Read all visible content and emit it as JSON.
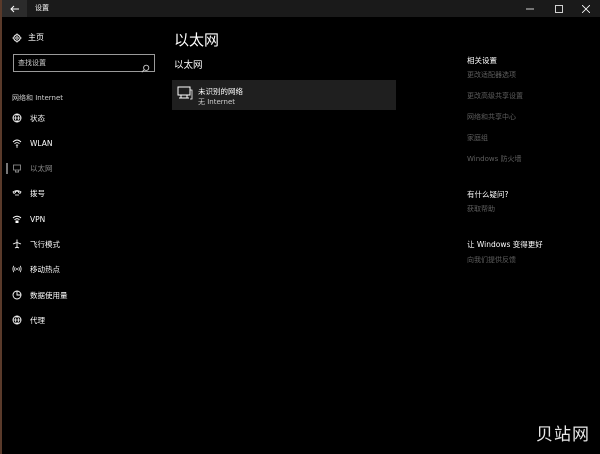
{
  "window": {
    "title": "设置"
  },
  "nav": {
    "home_label": "主页",
    "search_placeholder": "查找设置",
    "section_label": "网络和 Internet",
    "items": [
      {
        "label": "状态",
        "icon": "status-globe-icon"
      },
      {
        "label": "WLAN",
        "icon": "wifi-icon"
      },
      {
        "label": "以太网",
        "icon": "ethernet-icon",
        "selected": true
      },
      {
        "label": "拨号",
        "icon": "dialup-icon"
      },
      {
        "label": "VPN",
        "icon": "vpn-icon"
      },
      {
        "label": "飞行模式",
        "icon": "airplane-icon"
      },
      {
        "label": "移动热点",
        "icon": "hotspot-icon"
      },
      {
        "label": "数据使用量",
        "icon": "data-usage-icon"
      },
      {
        "label": "代理",
        "icon": "proxy-globe-icon"
      }
    ]
  },
  "main": {
    "title": "以太网",
    "section": "以太网",
    "network": {
      "name": "未识别的网络",
      "status": "无 Internet"
    }
  },
  "right": {
    "related_header": "相关设置",
    "related_links": [
      "更改适配器选项",
      "更改高级共享设置",
      "网络和共享中心",
      "家庭组",
      "Windows 防火墙"
    ],
    "help_header": "有什么疑问?",
    "help_link": "获取帮助",
    "feedback_header": "让 Windows 变得更好",
    "feedback_link": "向我们提供反馈"
  },
  "watermark": "贝站网",
  "colors": {
    "background": "#000000",
    "card": "#1f1f1f",
    "link_disabled": "#5f5f5f"
  }
}
